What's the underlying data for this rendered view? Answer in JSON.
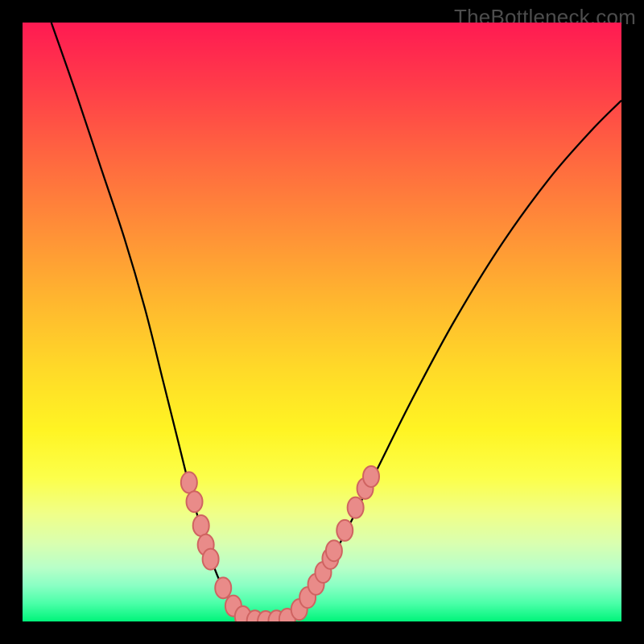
{
  "watermark": "TheBottleneck.com",
  "chart_data": {
    "type": "line",
    "title": "",
    "xlabel": "",
    "ylabel": "",
    "xlim": [
      0,
      1
    ],
    "ylim": [
      0,
      1
    ],
    "curve": {
      "left_branch": [
        {
          "x": 0.048,
          "y": 1.0
        },
        {
          "x": 0.09,
          "y": 0.88
        },
        {
          "x": 0.13,
          "y": 0.76
        },
        {
          "x": 0.17,
          "y": 0.64
        },
        {
          "x": 0.205,
          "y": 0.52
        },
        {
          "x": 0.235,
          "y": 0.4
        },
        {
          "x": 0.26,
          "y": 0.3
        },
        {
          "x": 0.28,
          "y": 0.22
        },
        {
          "x": 0.3,
          "y": 0.15
        },
        {
          "x": 0.32,
          "y": 0.09
        },
        {
          "x": 0.34,
          "y": 0.045
        },
        {
          "x": 0.36,
          "y": 0.015
        },
        {
          "x": 0.38,
          "y": 0.002
        }
      ],
      "trough": [
        {
          "x": 0.38,
          "y": 0.002
        },
        {
          "x": 0.41,
          "y": 0.0
        },
        {
          "x": 0.44,
          "y": 0.003
        }
      ],
      "right_branch": [
        {
          "x": 0.44,
          "y": 0.003
        },
        {
          "x": 0.47,
          "y": 0.03
        },
        {
          "x": 0.5,
          "y": 0.075
        },
        {
          "x": 0.54,
          "y": 0.15
        },
        {
          "x": 0.59,
          "y": 0.25
        },
        {
          "x": 0.65,
          "y": 0.37
        },
        {
          "x": 0.72,
          "y": 0.5
        },
        {
          "x": 0.8,
          "y": 0.63
        },
        {
          "x": 0.88,
          "y": 0.74
        },
        {
          "x": 0.95,
          "y": 0.82
        },
        {
          "x": 1.0,
          "y": 0.87
        }
      ]
    },
    "markers": [
      {
        "x": 0.278,
        "y": 0.232
      },
      {
        "x": 0.287,
        "y": 0.2
      },
      {
        "x": 0.298,
        "y": 0.16
      },
      {
        "x": 0.306,
        "y": 0.128
      },
      {
        "x": 0.314,
        "y": 0.104
      },
      {
        "x": 0.335,
        "y": 0.056
      },
      {
        "x": 0.352,
        "y": 0.026
      },
      {
        "x": 0.368,
        "y": 0.008
      },
      {
        "x": 0.388,
        "y": 0.001
      },
      {
        "x": 0.406,
        "y": 0.0
      },
      {
        "x": 0.424,
        "y": 0.001
      },
      {
        "x": 0.442,
        "y": 0.004
      },
      {
        "x": 0.462,
        "y": 0.02
      },
      {
        "x": 0.476,
        "y": 0.04
      },
      {
        "x": 0.49,
        "y": 0.062
      },
      {
        "x": 0.502,
        "y": 0.082
      },
      {
        "x": 0.514,
        "y": 0.105
      },
      {
        "x": 0.52,
        "y": 0.118
      },
      {
        "x": 0.538,
        "y": 0.152
      },
      {
        "x": 0.556,
        "y": 0.19
      },
      {
        "x": 0.572,
        "y": 0.222
      },
      {
        "x": 0.582,
        "y": 0.242
      }
    ]
  }
}
